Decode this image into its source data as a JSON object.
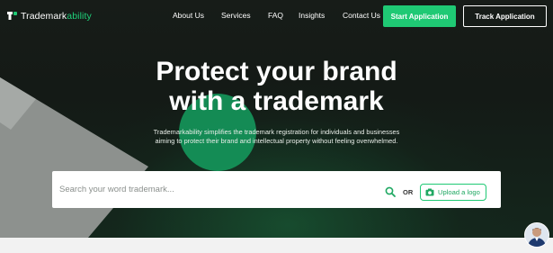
{
  "brand": {
    "name_prefix": "Trademark",
    "name_suffix": "ability",
    "accent_color": "#1fc974"
  },
  "nav": {
    "links": [
      "About Us",
      "Services",
      "FAQ",
      "Insights",
      "Contact Us"
    ],
    "start_label": "Start Application",
    "track_label": "Track Application"
  },
  "hero": {
    "headline_line1": "Protect your brand",
    "headline_line2": "with a trademark",
    "subtext_line1": "Trademarkability simplifies the trademark registration for individuals and businesses",
    "subtext_line2": "aiming to protect their brand and intellectual property without feeling overwhelmed."
  },
  "search": {
    "placeholder": "Search your word trademark...",
    "icon": "search-icon",
    "or_label": "OR",
    "upload_label": "Upload a logo",
    "upload_icon": "camera-icon"
  },
  "chat": {
    "icon": "avatar"
  }
}
